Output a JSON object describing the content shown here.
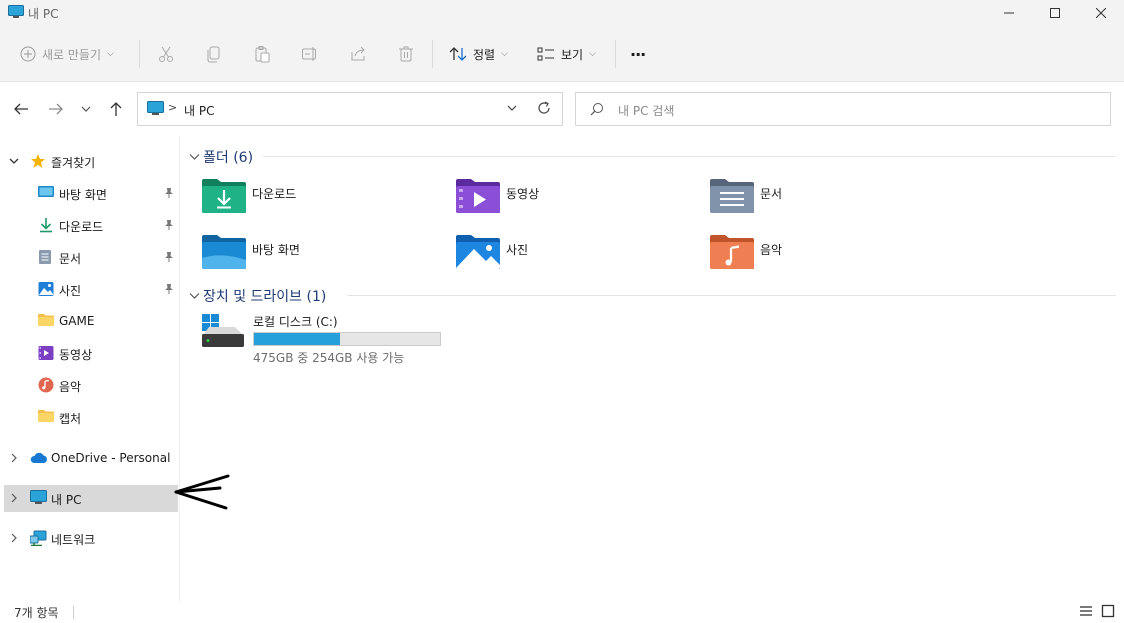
{
  "window": {
    "title": "내 PC"
  },
  "toolbar": {
    "new_label": "새로 만들기",
    "sort_label": "정렬",
    "view_label": "보기",
    "more_label": "···"
  },
  "address": {
    "path_label": "내 PC",
    "separator": ">"
  },
  "search": {
    "placeholder": "내 PC 검색"
  },
  "sidebar": {
    "favorites": {
      "label": "즐겨찾기"
    },
    "items": [
      {
        "label": "바탕 화면",
        "icon": "desktop-icon",
        "pinned": true
      },
      {
        "label": "다운로드",
        "icon": "download-icon",
        "pinned": true
      },
      {
        "label": "문서",
        "icon": "document-icon",
        "pinned": true
      },
      {
        "label": "사진",
        "icon": "pictures-icon",
        "pinned": true
      },
      {
        "label": "GAME",
        "icon": "folder-icon",
        "pinned": false
      },
      {
        "label": "동영상",
        "icon": "videos-icon",
        "pinned": false
      },
      {
        "label": "음악",
        "icon": "music-icon",
        "pinned": false
      },
      {
        "label": "캡처",
        "icon": "folder-icon",
        "pinned": false
      }
    ],
    "onedrive": {
      "label": "OneDrive - Personal"
    },
    "this_pc": {
      "label": "내 PC",
      "selected": true
    },
    "network": {
      "label": "네트워크"
    }
  },
  "main": {
    "folders_group": {
      "title": "폴더 (6)",
      "items": [
        {
          "label": "다운로드",
          "icon": "download-folder-icon"
        },
        {
          "label": "동영상",
          "icon": "videos-folder-icon"
        },
        {
          "label": "문서",
          "icon": "documents-folder-icon"
        },
        {
          "label": "바탕 화면",
          "icon": "desktop-folder-icon"
        },
        {
          "label": "사진",
          "icon": "pictures-folder-icon"
        },
        {
          "label": "음악",
          "icon": "music-folder-icon"
        }
      ]
    },
    "drives_group": {
      "title": "장치 및 드라이브 (1)",
      "drives": [
        {
          "label": "로컬 디스크 (C:)",
          "info": "475GB 중 254GB 사용 가능",
          "used_fraction": 0.465
        }
      ]
    }
  },
  "status": {
    "item_count": "7개 항목"
  },
  "colors": {
    "accent": "#26a0da",
    "selection": "#d9d9d9",
    "group_title": "#1f3b73"
  }
}
